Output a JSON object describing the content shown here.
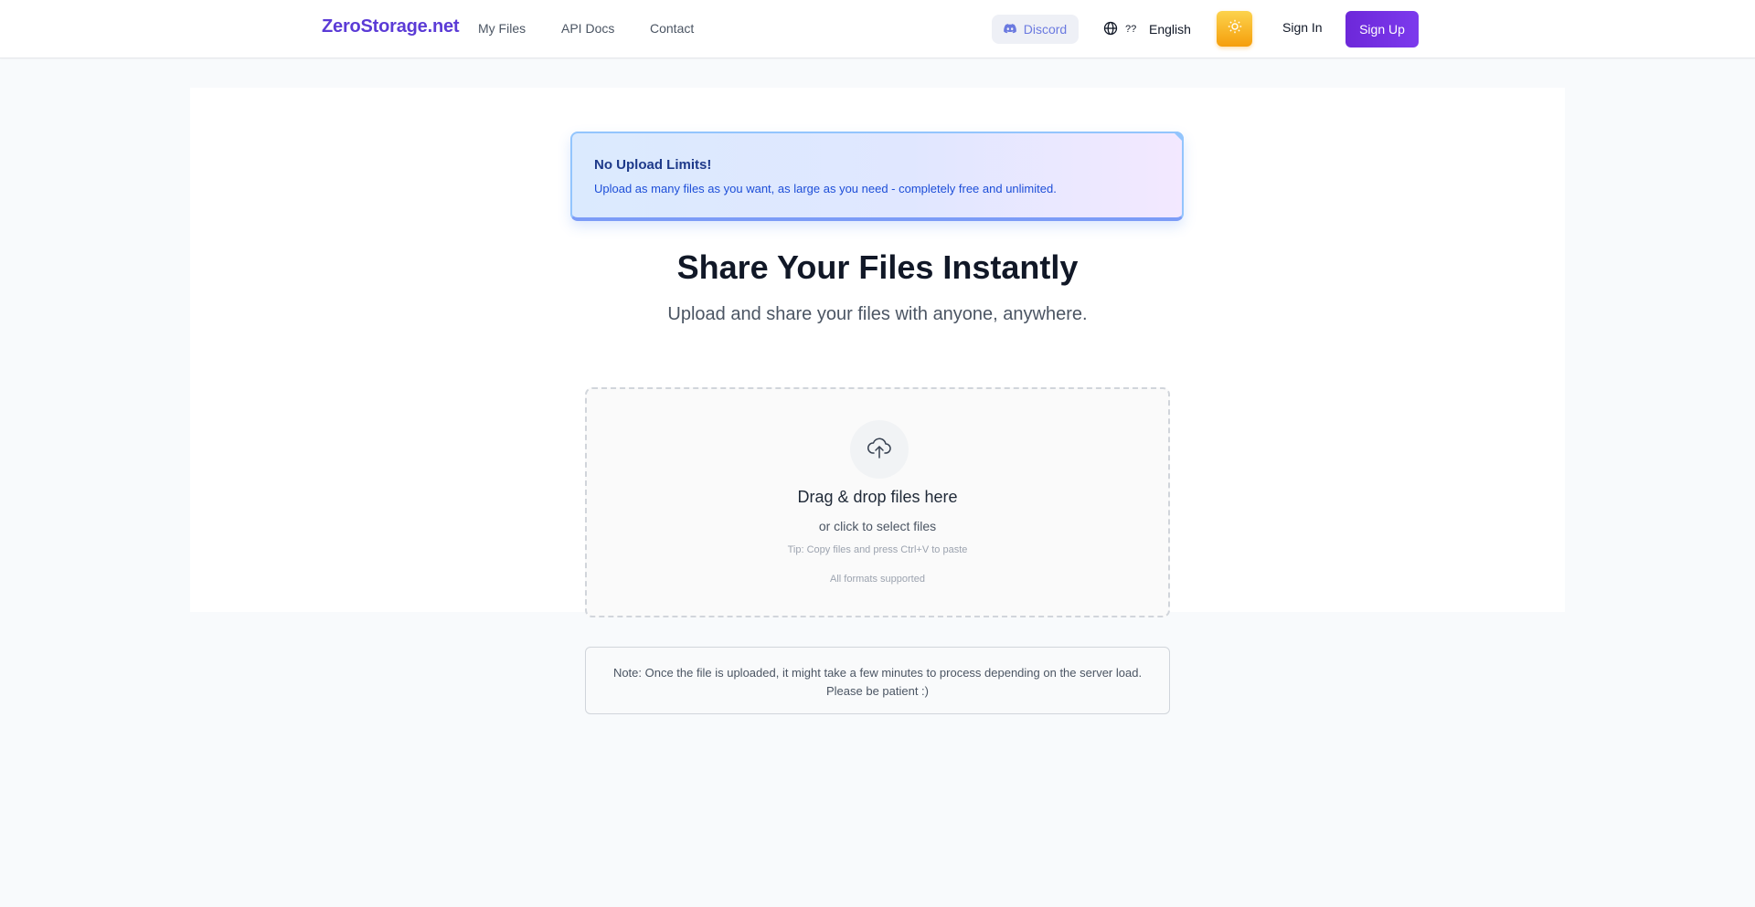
{
  "header": {
    "brand": "ZeroStorage.net",
    "nav": [
      {
        "label": "My Files"
      },
      {
        "label": "API Docs"
      },
      {
        "label": "Contact"
      }
    ],
    "discord_label": "Discord",
    "language_flag": "??",
    "language_label": "English",
    "theme_icon": "sun-icon",
    "signin_label": "Sign In",
    "signup_label": "Sign Up"
  },
  "promo": {
    "title": "No Upload Limits!",
    "text": "Upload as many files as you want, as large as you need - completely free and unlimited."
  },
  "hero": {
    "title": "Share Your Files Instantly",
    "subtitle": "Upload and share your files with anyone, anywhere."
  },
  "dropzone": {
    "icon": "cloud-upload-icon",
    "title": "Drag & drop files here",
    "subtitle": "or click to select files",
    "tip": "Tip: Copy files and press Ctrl+V to paste",
    "formats": "All formats supported"
  },
  "note": {
    "text": "Note: Once the file is uploaded, it might take a few minutes to process depending on the server load. Please be patient :)"
  },
  "colors": {
    "brand": "#5b3bd6",
    "signup": "#7c3aed",
    "theme_button": "#fbbf24",
    "discord_text": "#6b7ae0"
  }
}
